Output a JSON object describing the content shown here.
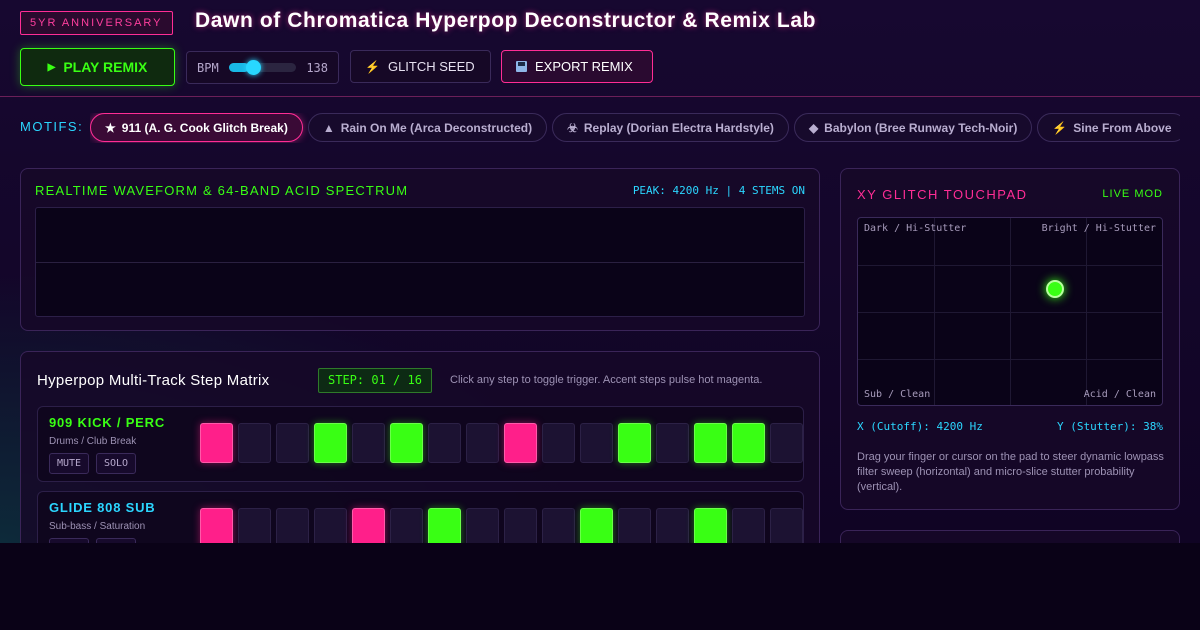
{
  "header": {
    "badge": "5YR ANNIVERSARY",
    "title": "Dawn of Chromatica Hyperpop Deconstructor & Remix Lab",
    "play_label": "PLAY REMIX",
    "bpm_label": "BPM",
    "bpm_value": "138",
    "bpm_slider_fraction": 0.3,
    "seed_label": "GLITCH SEED",
    "export_label": "EXPORT REMIX"
  },
  "motifs": {
    "label": "MOTIFS:",
    "items": [
      {
        "icon": "star-icon",
        "glyph": "★",
        "label": "911 (A. G. Cook Glitch Break)",
        "active": true
      },
      {
        "icon": "triangle-icon",
        "glyph": "▲",
        "label": "Rain On Me (Arca Deconstructed)",
        "active": false
      },
      {
        "icon": "biohazard-icon",
        "glyph": "☣",
        "label": "Replay (Dorian Electra Hardstyle)",
        "active": false
      },
      {
        "icon": "diamond-icon",
        "glyph": "◆",
        "label": "Babylon (Bree Runway Tech-Noir)",
        "active": false
      },
      {
        "icon": "lightning-icon",
        "glyph": "⚡",
        "label": "Sine From Above",
        "active": false
      }
    ]
  },
  "waveform": {
    "title": "REALTIME WAVEFORM & 64-BAND ACID SPECTRUM",
    "peak": "PEAK: 4200 Hz | 4 STEMS ON"
  },
  "xy": {
    "title": "XY GLITCH TOUCHPAD",
    "live": "LIVE MOD",
    "corner_tl": "Dark / Hi-Stutter",
    "corner_tr": "Bright / Hi-Stutter",
    "corner_bl": "Sub / Clean",
    "corner_br": "Acid / Clean",
    "x_readout": "X (Cutoff): 4200 Hz",
    "y_readout": "Y (Stutter): 38%",
    "hint": "Drag your finger or cursor on the pad to steer dynamic lowpass filter sweep (horizontal) and micro-slice stutter probability (vertical)."
  },
  "matrix": {
    "title": "Hyperpop Multi-Track Step Matrix",
    "step": "STEP: 01 / 16",
    "hint": "Click any step to toggle trigger. Accent steps pulse hot magenta.",
    "mute_label": "MUTE",
    "solo_label": "SOLO",
    "tracks": [
      {
        "name": "909 KICK / PERC",
        "sub": "Drums / Club Break",
        "color": "#39ff14",
        "steps": [
          "a",
          "o",
          "o",
          "g",
          "o",
          "g",
          "o",
          "o",
          "a",
          "o",
          "o",
          "g",
          "o",
          "g",
          "g",
          "o"
        ]
      },
      {
        "name": "GLIDE 808 SUB",
        "sub": "Sub-bass / Saturation",
        "color": "#2bd6ff",
        "steps": [
          "a",
          "o",
          "o",
          "o",
          "a",
          "o",
          "g",
          "o",
          "o",
          "o",
          "g",
          "o",
          "o",
          "g",
          "o",
          "o"
        ]
      }
    ]
  },
  "colors": {
    "accent": "#ff2d95",
    "green": "#39ff14",
    "cyan": "#2bd6ff"
  }
}
